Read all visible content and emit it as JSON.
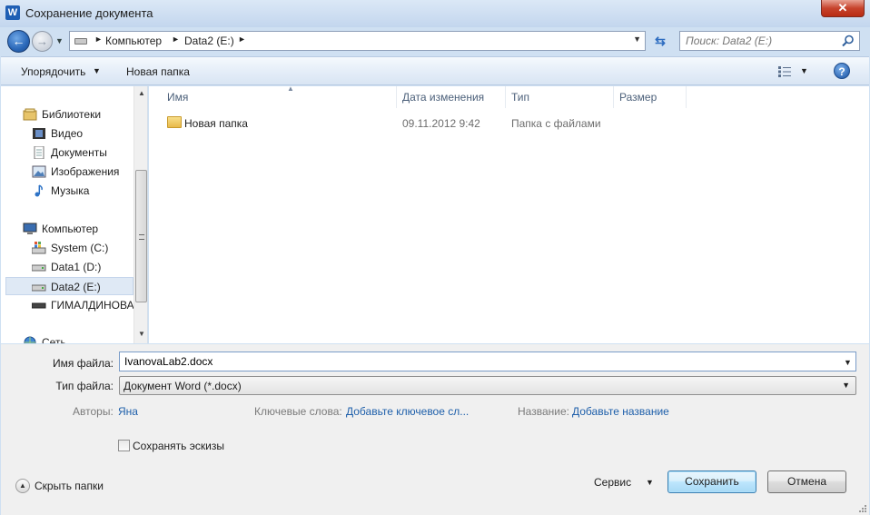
{
  "window": {
    "title": "Сохранение документа",
    "app_icon_letter": "W",
    "close_glyph": "✕"
  },
  "address": {
    "crumbs": [
      "Компьютер",
      "Data2 (E:)"
    ],
    "search_placeholder": "Поиск: Data2 (E:)"
  },
  "toolbar": {
    "organize": "Упорядочить",
    "new_folder": "Новая папка",
    "help": "?"
  },
  "nav": {
    "libraries": "Библиотеки",
    "video": "Видео",
    "documents": "Документы",
    "images": "Изображения",
    "music": "Музыка",
    "computer": "Компьютер",
    "drive_c": "System (C:)",
    "drive_d": "Data1 (D:)",
    "drive_e": "Data2 (E:)",
    "drive_usb": "ГИМАЛДИНОВА",
    "network": "Сеть"
  },
  "columns": {
    "name": "Имя",
    "date": "Дата изменения",
    "type": "Тип",
    "size": "Размер"
  },
  "files": [
    {
      "name": "Новая папка",
      "date": "09.11.2012 9:42",
      "type": "Папка с файлами",
      "size": ""
    }
  ],
  "form": {
    "filename_label": "Имя файла:",
    "filename_value": "IvanovaLab2.docx",
    "filetype_label": "Тип файла:",
    "filetype_value": "Документ Word (*.docx)",
    "authors_label": "Авторы:",
    "authors_value": "Яна",
    "keywords_label": "Ключевые слова:",
    "keywords_value": "Добавьте ключевое сл...",
    "title_label": "Название:",
    "title_value": "Добавьте название",
    "thumbnails_label": "Сохранять эскизы",
    "thumbnails_checked": false,
    "hide_folders": "Скрыть папки",
    "service": "Сервис",
    "save": "Сохранить",
    "cancel": "Отмена"
  }
}
